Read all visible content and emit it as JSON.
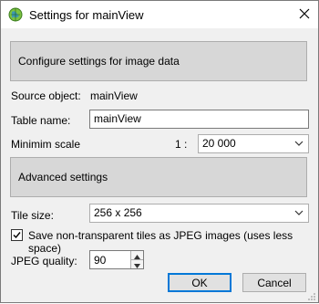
{
  "window": {
    "title": "Settings for mainView",
    "icon": "app-globe-icon",
    "close_icon": "close-icon"
  },
  "sections": {
    "configure_label": "Configure settings for image data",
    "advanced_label": "Advanced settings"
  },
  "fields": {
    "source_object_label": "Source object:",
    "source_object_value": "mainView",
    "table_name_label": "Table name:",
    "table_name_value": "mainView",
    "min_scale_label": "Minimim scale",
    "scale_prefix": "1 :",
    "min_scale_value": "20  000",
    "tile_size_label": "Tile size:",
    "tile_size_value": "256 x 256",
    "save_jpeg_label": "Save non-transparent tiles as JPEG images (uses less space)",
    "save_jpeg_checked": true,
    "jpeg_quality_label": "JPEG quality:",
    "jpeg_quality_value": "90"
  },
  "buttons": {
    "ok": "OK",
    "cancel": "Cancel"
  },
  "colors": {
    "accent": "#0078d7",
    "section_bg": "#d7d7d7",
    "dialog_bg": "#f0f0f0"
  }
}
